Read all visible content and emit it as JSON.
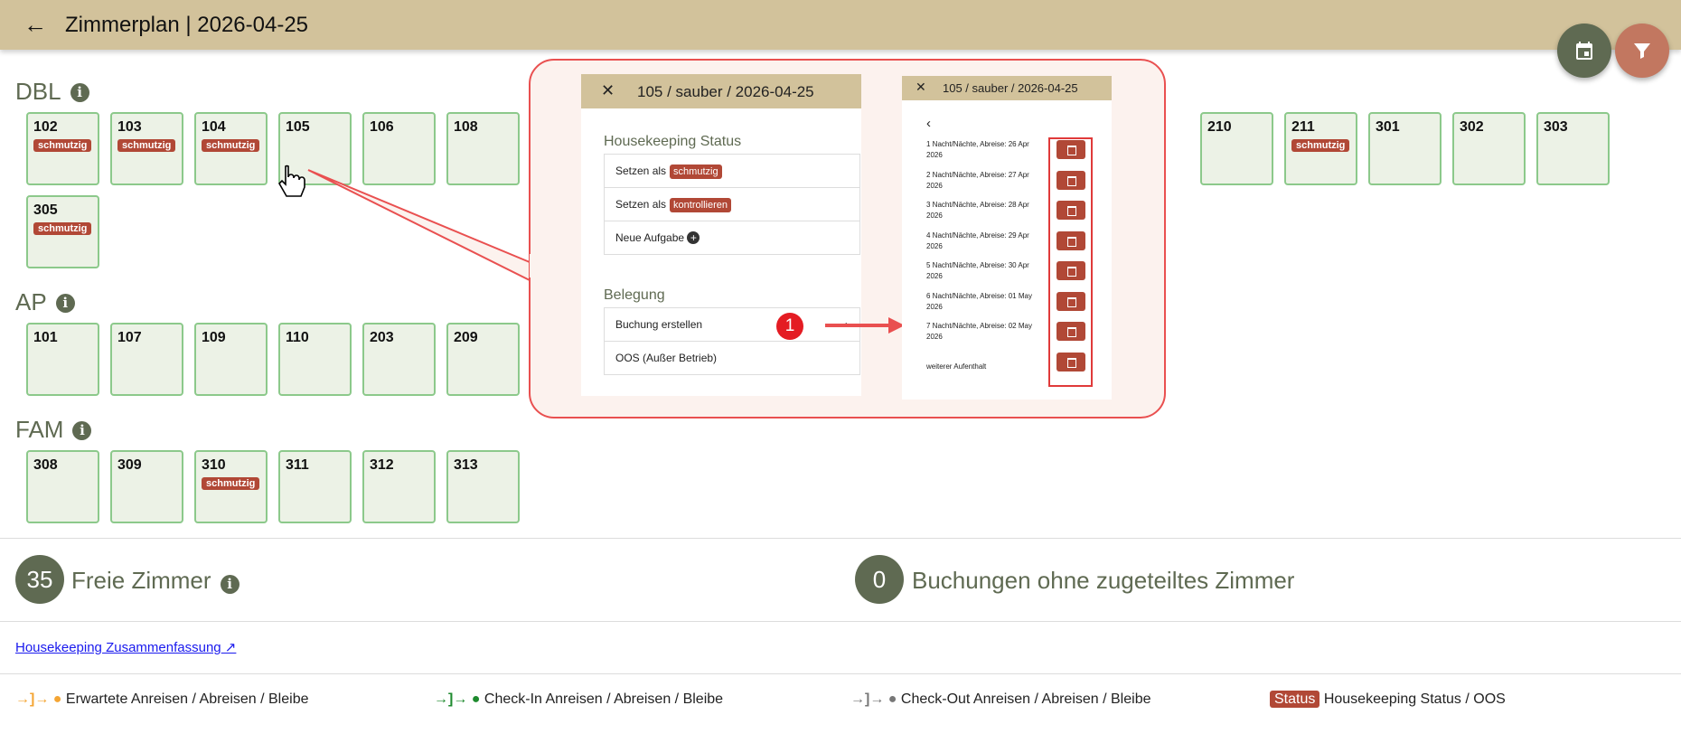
{
  "header": {
    "title": "Zimmerplan | 2026-04-25"
  },
  "sections": [
    {
      "label": "DBL",
      "rooms": [
        [
          "102",
          "schmutzig"
        ],
        [
          "103",
          "schmutzig"
        ],
        [
          "104",
          "schmutzig"
        ],
        [
          "105",
          ""
        ],
        [
          "106",
          ""
        ],
        [
          "108",
          ""
        ],
        [
          "210",
          ""
        ],
        [
          "211",
          "schmutzig"
        ],
        [
          "301",
          ""
        ],
        [
          "302",
          ""
        ],
        [
          "303",
          ""
        ],
        [
          "305",
          "schmutzig"
        ]
      ]
    },
    {
      "label": "AP",
      "rooms": [
        [
          "101",
          ""
        ],
        [
          "107",
          ""
        ],
        [
          "109",
          ""
        ],
        [
          "110",
          ""
        ],
        [
          "203",
          ""
        ],
        [
          "209",
          ""
        ]
      ]
    },
    {
      "label": "FAM",
      "rooms": [
        [
          "308",
          ""
        ],
        [
          "309",
          ""
        ],
        [
          "310",
          "schmutzig"
        ],
        [
          "311",
          ""
        ],
        [
          "312",
          ""
        ],
        [
          "313",
          ""
        ]
      ]
    }
  ],
  "summary": {
    "free_count": "35",
    "free_label": "Freie Zimmer",
    "unassigned_count": "0",
    "unassigned_label": "Buchungen ohne zugeteiltes Zimmer"
  },
  "link": "Housekeeping Zusammenfassung",
  "legend": {
    "expected": "Erwartete Anreisen / Abreisen / Bleibe",
    "checkin": "Check-In Anreisen / Abreisen / Bleibe",
    "checkout": "Check-Out Anreisen / Abreisen / Bleibe",
    "status_badge": "Status",
    "status": "Housekeeping Status / OOS"
  },
  "popup": {
    "screen1": {
      "title": "105 / sauber / 2026-04-25",
      "hk_heading": "Housekeeping Status",
      "set_as": "Setzen als",
      "status1": "schmutzig",
      "status2": "kontrollieren",
      "new_task": "Neue Aufgabe",
      "belegung": "Belegung",
      "create_booking": "Buchung erstellen",
      "oos": "OOS (Außer Betrieb)",
      "step": "1"
    },
    "screen2": {
      "title": "105 / sauber / 2026-04-25",
      "options": [
        "1 Nacht/Nächte, Abreise: 26 Apr 2026",
        "2 Nacht/Nächte, Abreise: 27 Apr 2026",
        "3 Nacht/Nächte, Abreise: 28 Apr 2026",
        "4 Nacht/Nächte, Abreise: 29 Apr 2026",
        "5 Nacht/Nächte, Abreise: 30 Apr 2026",
        "6 Nacht/Nächte, Abreise: 01 May 2026",
        "7 Nacht/Nächte, Abreise: 02 May 2026",
        "weiterer Aufenthalt"
      ]
    }
  },
  "colors": {
    "accent": "#d2c29b",
    "olive": "#5f6a52",
    "dirty": "#b14836",
    "expected": "#f4a534",
    "checkin": "#1e8a2e",
    "checkout": "#777777"
  }
}
